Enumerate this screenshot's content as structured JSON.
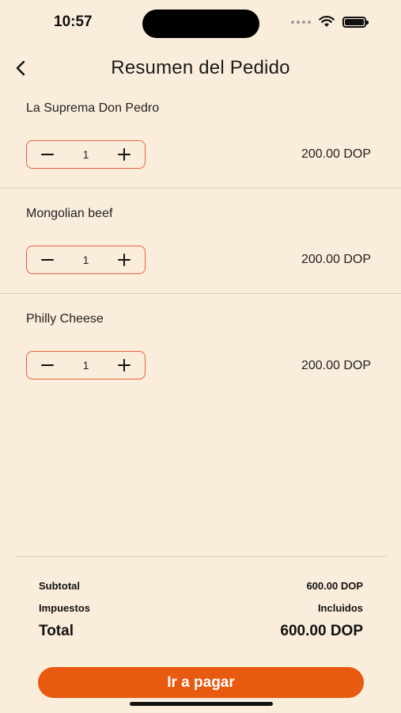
{
  "status_bar": {
    "time": "10:57",
    "battery_level": 1.0
  },
  "nav": {
    "title": "Resumen del Pedido",
    "back_icon": "chevron-left-icon"
  },
  "items": [
    {
      "name": "La Suprema Don Pedro",
      "quantity": "1",
      "price": "200.00 DOP"
    },
    {
      "name": "Mongolian beef",
      "quantity": "1",
      "price": "200.00 DOP"
    },
    {
      "name": "Philly Cheese",
      "quantity": "1",
      "price": "200.00 DOP"
    }
  ],
  "summary": {
    "subtotal_label": "Subtotal",
    "subtotal_value": "600.00 DOP",
    "taxes_label": "Impuestos",
    "taxes_value": "Incluidos",
    "total_label": "Total",
    "total_value": "600.00 DOP"
  },
  "checkout": {
    "button_label": "Ir a pagar"
  },
  "colors": {
    "background": "#fbeddb",
    "accent": "#e85a10",
    "stepper_border": "#e8623a"
  }
}
